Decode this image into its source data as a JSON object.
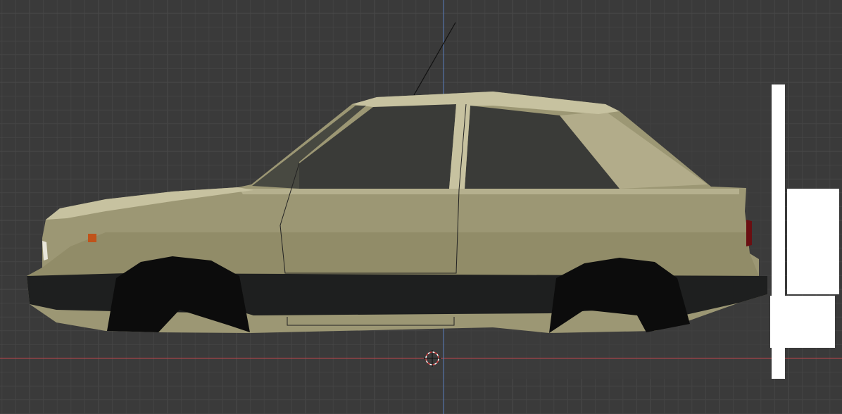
{
  "viewport": {
    "background": "#3a3a3a",
    "grid_minor_color": "#444444",
    "grid_major_color": "#4a4a4a",
    "axis_x_color": "#c0454c",
    "axis_z_color": "#5b7fbf"
  },
  "model": {
    "body_color": "#9c9774",
    "body_light_color": "#c7c2a0",
    "body_shadow_color": "#7d7854",
    "bumper_color": "#1e1f1f",
    "wheel_well_color": "#0c0c0c",
    "glass_color": "#3a3b38",
    "indicator_color": "#c0531a",
    "taillight_color": "#6a0f12"
  },
  "overlay": {
    "reference_color": "#ffffff",
    "cursor_icon": "3d-cursor-icon"
  }
}
